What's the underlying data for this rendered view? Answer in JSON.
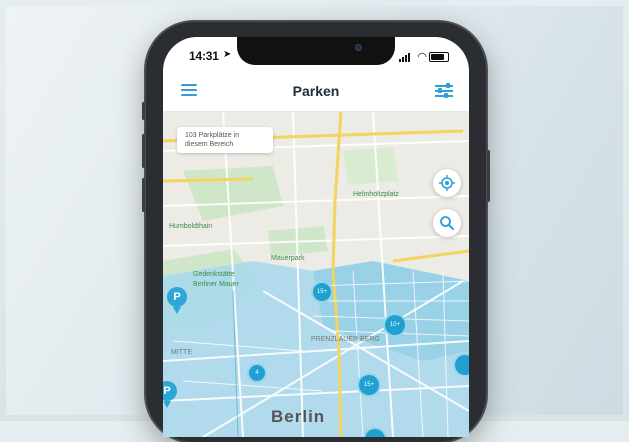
{
  "status_bar": {
    "time": "14:31"
  },
  "nav": {
    "title": "Parken"
  },
  "map": {
    "info_line1": "103 Parkplätze in",
    "info_line2": "diesem Bereich",
    "city_label": "Berlin",
    "labels": {
      "humboldthain": "Humboldthain",
      "helmholtzplatz": "Helmholtzplatz",
      "mauerpark": "Mauerpark",
      "gedenkstaette": "Gedenkstätte",
      "berliner_mauer": "Berliner Mauer",
      "mitte": "MITTE",
      "prenzlauer": "PRENZLAUER BERG"
    },
    "clusters": [
      "15+",
      "10+",
      "4",
      "15+"
    ],
    "pin_letter": "P"
  },
  "colors": {
    "accent": "#2f9fd6",
    "zone": "#9fd3ea",
    "cluster": "#1fa0d0"
  }
}
